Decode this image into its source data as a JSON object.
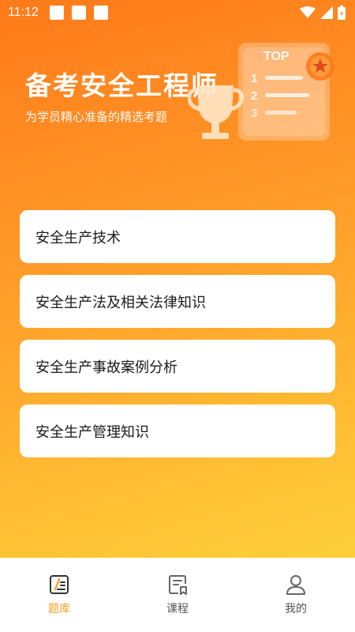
{
  "status_bar": {
    "time": "11:12"
  },
  "header": {
    "title": "备考安全工程师",
    "subtitle": "为学员精心准备的精选考题",
    "badge_text": "TOP",
    "rank_numbers": [
      "1",
      "2",
      "3"
    ]
  },
  "categories": [
    {
      "label": "安全生产技术"
    },
    {
      "label": "安全生产法及相关法律知识"
    },
    {
      "label": "安全生产事故案例分析"
    },
    {
      "label": "安全生产管理知识"
    }
  ],
  "nav": {
    "items": [
      {
        "label": "题库",
        "icon": "question-bank-icon",
        "active": true
      },
      {
        "label": "课程",
        "icon": "course-icon",
        "active": false
      },
      {
        "label": "我的",
        "icon": "profile-icon",
        "active": false
      }
    ]
  },
  "colors": {
    "accent": "#f7a11c",
    "gradient_start": "#ff7a1a",
    "gradient_end": "#ffcf3a",
    "card_bg": "#ffffff",
    "nav_inactive": "#555555"
  }
}
